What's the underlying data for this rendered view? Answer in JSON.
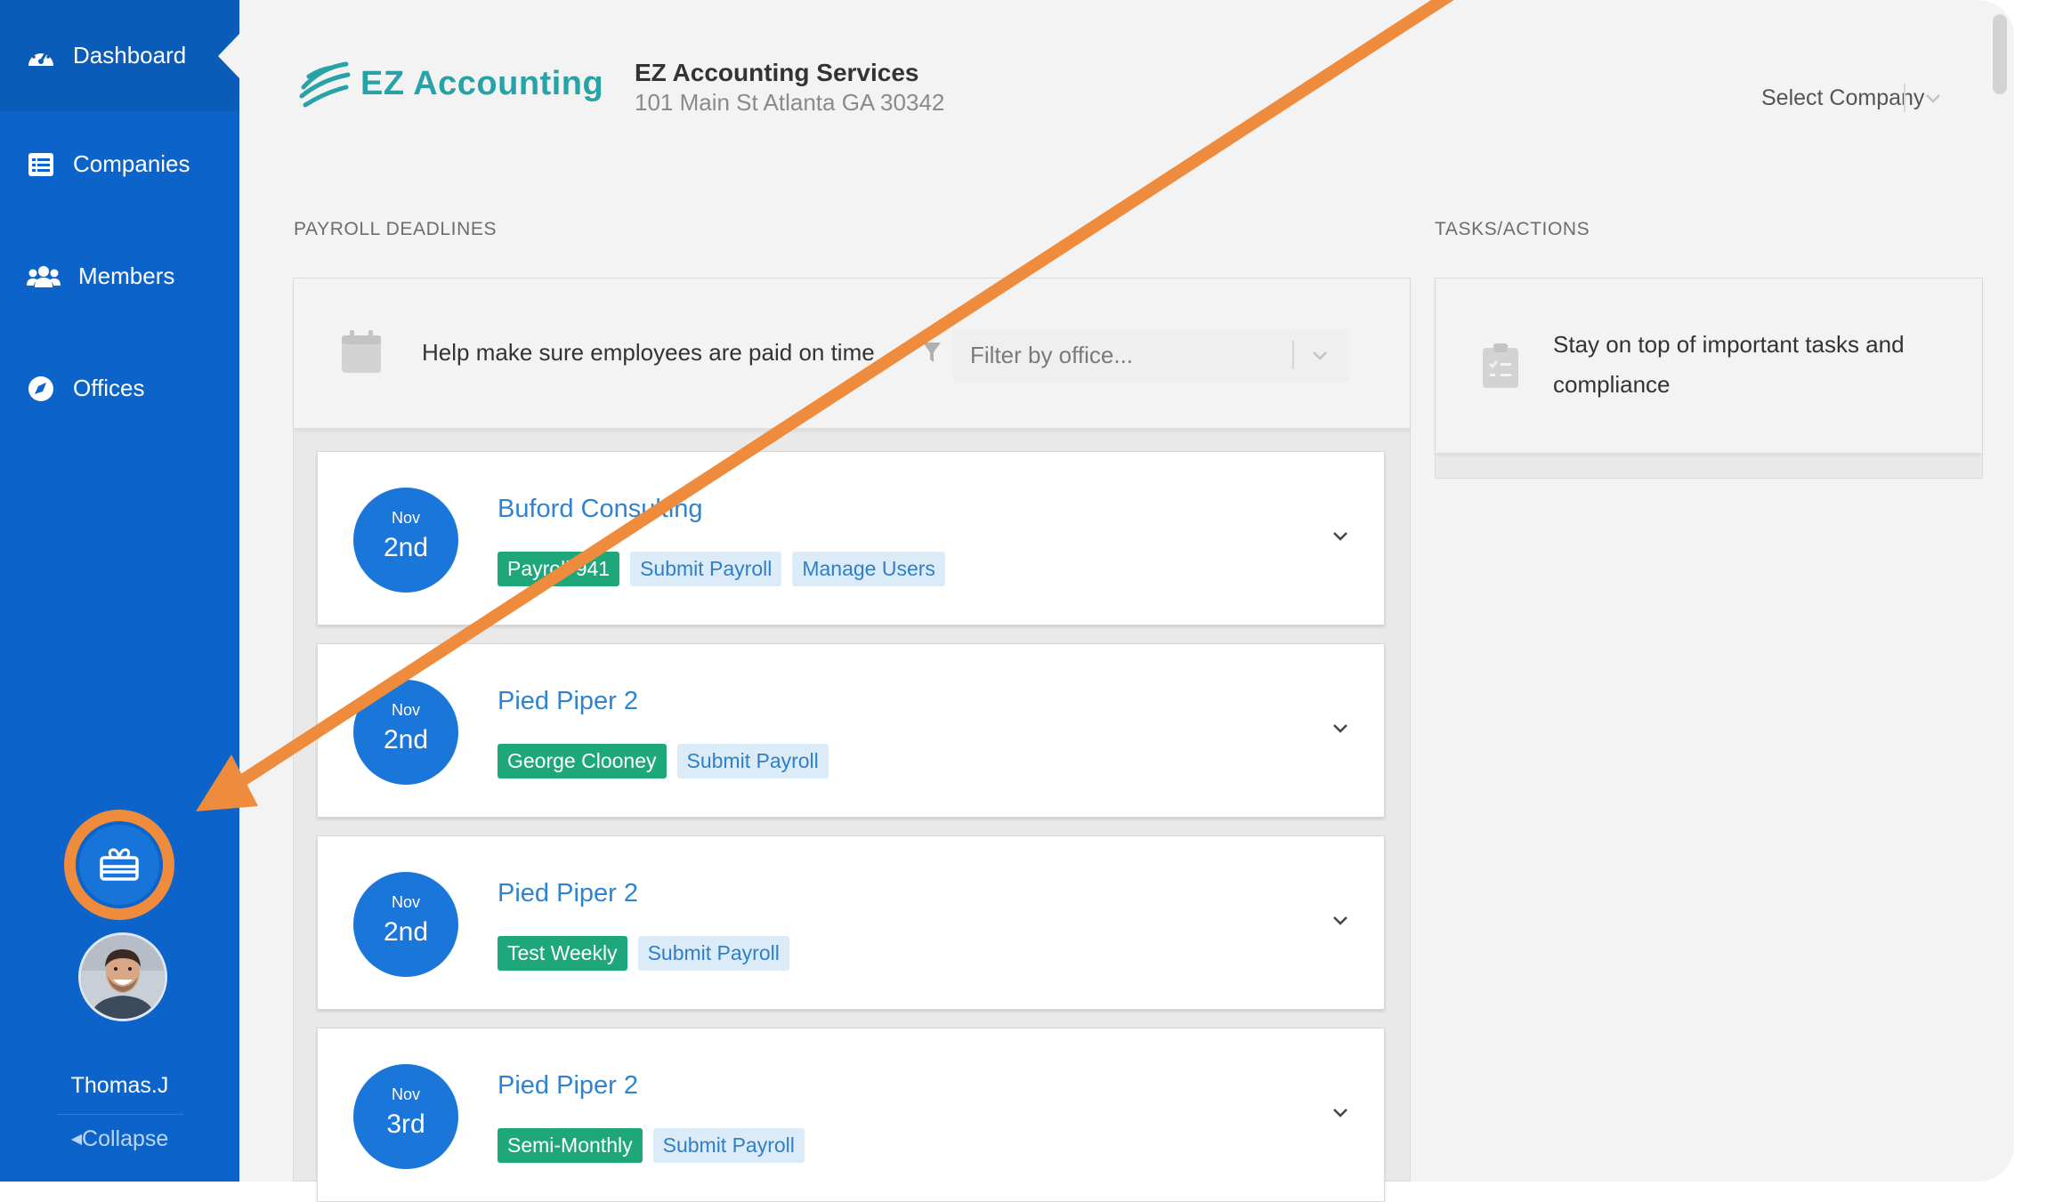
{
  "sidebar": {
    "items": [
      {
        "label": "Dashboard",
        "icon": "dashboard-gauge-icon"
      },
      {
        "label": "Companies",
        "icon": "list-icon"
      },
      {
        "label": "Members",
        "icon": "users-icon"
      },
      {
        "label": "Offices",
        "icon": "compass-icon"
      }
    ],
    "gift_icon": "gift-icon",
    "username": "Thomas.J",
    "collapse_label": "Collapse"
  },
  "header": {
    "logo_text": "EZ Accounting",
    "firm_name": "EZ Accounting Services",
    "firm_address": "101 Main St Atlanta GA 30342",
    "company_select_placeholder": "Select Company"
  },
  "payroll": {
    "section_title": "PAYROLL DEADLINES",
    "help_text": "Help make sure employees are paid on time",
    "filter_placeholder": "Filter by office...",
    "cards": [
      {
        "month": "Nov",
        "day": "2nd",
        "title": "Buford Consulting",
        "tags": [
          {
            "label": "Payroll 941",
            "style": "green"
          },
          {
            "label": "Submit Payroll",
            "style": "blue"
          },
          {
            "label": "Manage Users",
            "style": "blue"
          }
        ]
      },
      {
        "month": "Nov",
        "day": "2nd",
        "title": "Pied Piper 2",
        "tags": [
          {
            "label": "George Clooney",
            "style": "green"
          },
          {
            "label": "Submit Payroll",
            "style": "blue"
          }
        ]
      },
      {
        "month": "Nov",
        "day": "2nd",
        "title": "Pied Piper 2",
        "tags": [
          {
            "label": "Test Weekly",
            "style": "green"
          },
          {
            "label": "Submit Payroll",
            "style": "blue"
          }
        ]
      },
      {
        "month": "Nov",
        "day": "3rd",
        "title": "Pied Piper 2",
        "tags": [
          {
            "label": "Semi-Monthly",
            "style": "green"
          },
          {
            "label": "Submit Payroll",
            "style": "blue"
          }
        ]
      }
    ]
  },
  "tasks": {
    "section_title": "TASKS/ACTIONS",
    "text": "Stay on top of important tasks and compliance"
  },
  "colors": {
    "sidebar": "#0c63c9",
    "accent_blue": "#1a76d8",
    "tag_green": "#1fa77c",
    "tag_blue_bg": "#dcebf8",
    "annotation_orange": "#ef8b3c",
    "logo_teal": "#27a2a6"
  }
}
